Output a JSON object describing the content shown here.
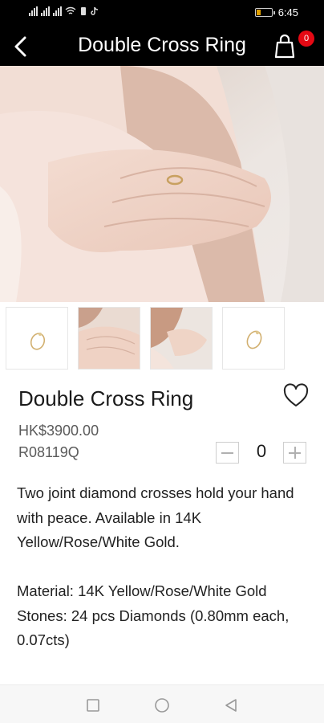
{
  "status_bar": {
    "time": "6:45"
  },
  "header": {
    "title": "Double Cross Ring",
    "cart_count": "0"
  },
  "product": {
    "name": "Double Cross Ring",
    "price": "HK$3900.00",
    "sku": "R08119Q",
    "quantity": "0",
    "description": [
      "Two joint diamond crosses hold your hand with peace. Available in 14K Yellow/Rose/White Gold.",
      "Material: 14K Yellow/Rose/White Gold",
      "Stones: 24 pcs Diamonds (0.80mm each, 0.07cts)"
    ]
  },
  "icons": {
    "back": "back-arrow-icon",
    "cart": "shopping-bag-icon",
    "wishlist": "heart-outline-icon",
    "nav": [
      "recent-apps-icon",
      "home-icon",
      "back-icon"
    ]
  },
  "colors": {
    "header_bg": "#000000",
    "badge": "#e50914",
    "text": "#1a1a1a",
    "muted": "#5a5a5a"
  }
}
